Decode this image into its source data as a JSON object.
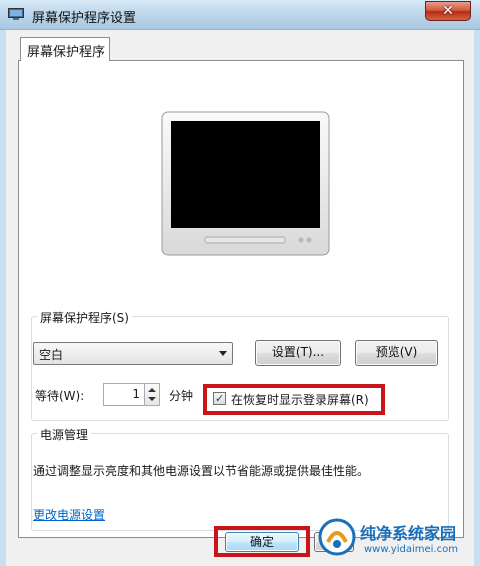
{
  "window": {
    "title": "屏幕保护程序设置",
    "close_label": "✕"
  },
  "tab": {
    "label": "屏幕保护程序"
  },
  "screensaver": {
    "group_label": "屏幕保护程序(S)",
    "selected": "空白",
    "settings_label": "设置(T)...",
    "preview_label": "预览(V)",
    "wait_label": "等待(W):",
    "wait_value": "1",
    "minutes_label": "分钟",
    "resume_checked": true,
    "resume_label": "在恢复时显示登录屏幕(R)"
  },
  "power": {
    "group_label": "电源管理",
    "description": "通过调整显示亮度和其他电源设置以节省能源或提供最佳性能。",
    "link_label": "更改电源设置"
  },
  "footer": {
    "ok_label": "确定"
  },
  "watermark": {
    "title": "纯净系统家园",
    "url": "www.yidaimei.com"
  },
  "colors": {
    "highlight": "#c8141a",
    "link": "#0066cc"
  }
}
